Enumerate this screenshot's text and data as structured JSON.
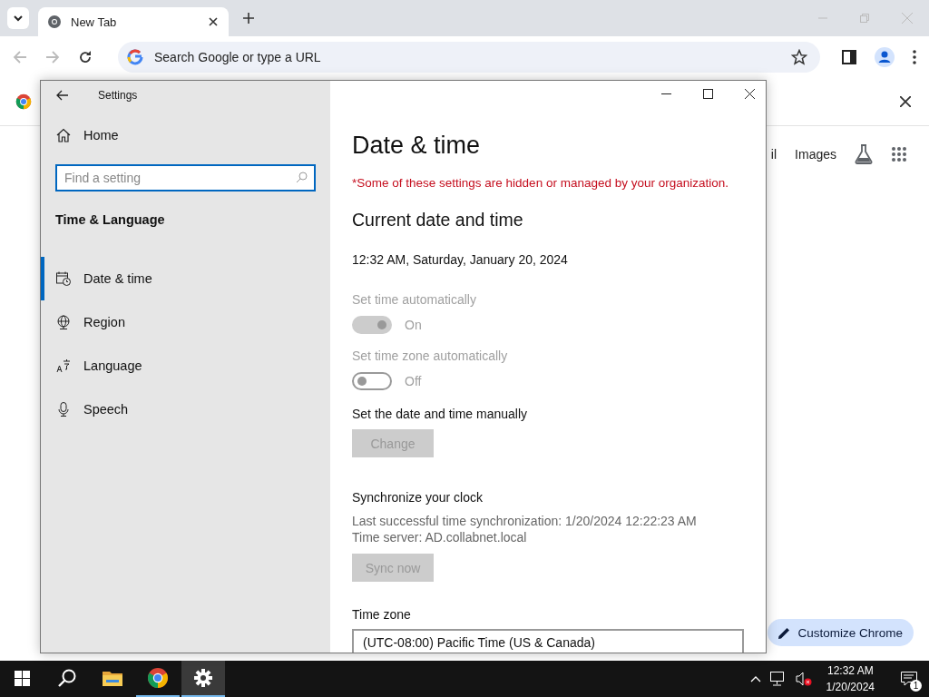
{
  "browser": {
    "tabs": [
      {
        "title": "New Tab",
        "selected": true
      }
    ],
    "omnibox": {
      "placeholder": "Search Google or type a URL"
    },
    "ntp": {
      "links": [
        "il",
        "Images"
      ],
      "customize_button": "Customize Chrome"
    }
  },
  "settings_window": {
    "title": "Settings",
    "sidebar": {
      "home": "Home",
      "search": {
        "placeholder": "Find a setting"
      },
      "section": "Time & Language",
      "items": [
        {
          "label": "Date & time",
          "kind": "calendar",
          "selected": true
        },
        {
          "label": "Region",
          "kind": "globe",
          "selected": false
        },
        {
          "label": "Language",
          "kind": "language",
          "selected": false
        },
        {
          "label": "Speech",
          "kind": "microphone",
          "selected": false
        }
      ]
    },
    "page": {
      "title": "Date & time",
      "notice": "*Some of these settings are hidden or managed by your organization.",
      "heading": "Current date and time",
      "current": "12:32 AM, Saturday, January 20, 2024",
      "toggles": [
        {
          "label": "Set time automatically",
          "on": true,
          "disabled": true,
          "state_text": "On"
        },
        {
          "label": "Set time zone automatically",
          "on": false,
          "disabled": true,
          "state_text": "Off"
        }
      ],
      "manual": {
        "label": "Set the date and time manually",
        "button": "Change",
        "disabled": true
      },
      "sync": {
        "heading": "Synchronize your clock",
        "lines": [
          "Last successful time synchronization: 1/20/2024 12:22:23 AM",
          "Time server: AD.collabnet.local"
        ],
        "button": "Sync now",
        "disabled": true
      },
      "time_zone": {
        "label": "Time zone",
        "value": "(UTC-08:00) Pacific Time (US & Canada)"
      }
    }
  },
  "taskbar": {
    "apps": [
      {
        "kind": "start",
        "running": false,
        "selected": false
      },
      {
        "kind": "search",
        "running": false,
        "selected": false
      },
      {
        "kind": "folder",
        "running": false,
        "selected": false
      },
      {
        "kind": "chrome",
        "running": true,
        "selected": false
      },
      {
        "kind": "gear",
        "running": true,
        "selected": true
      }
    ],
    "clock": {
      "time": "12:32 AM",
      "date": "1/20/2024"
    },
    "notifications": "1"
  }
}
